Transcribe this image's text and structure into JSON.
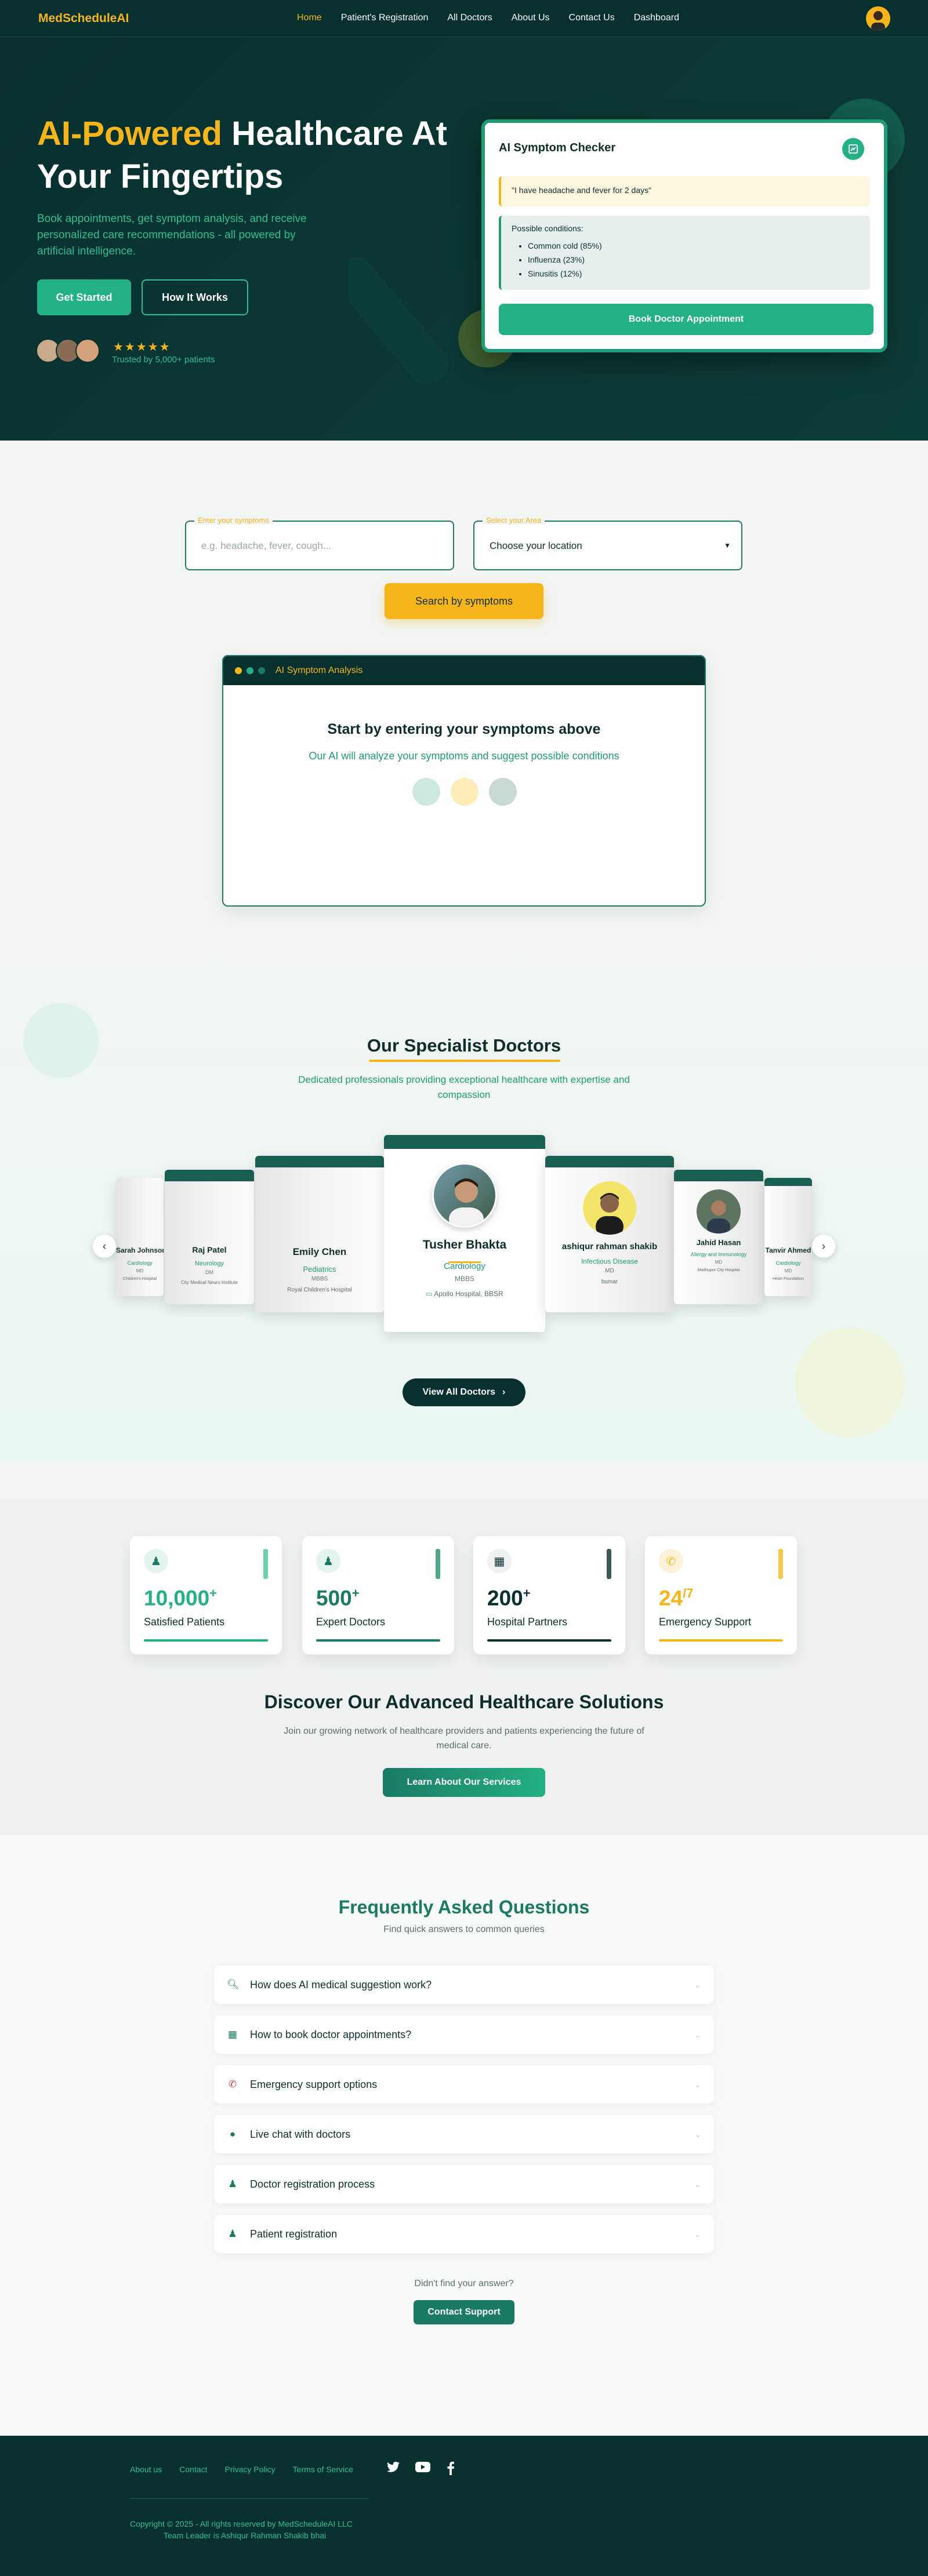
{
  "nav": {
    "logo": "MedScheduleAI",
    "links": [
      "Home",
      "Patient's Registration",
      "All Doctors",
      "About Us",
      "Contact Us",
      "Dashboard"
    ],
    "active": "Home"
  },
  "hero": {
    "title_highlight": "AI-Powered",
    "title_rest": " Healthcare At Your Fingertips",
    "subtitle": "Book appointments, get symptom analysis, and receive personalized care recommendations - all powered by artificial intelligence.",
    "get_started": "Get Started",
    "how_it_works": "How It Works",
    "stars": "★★★★★",
    "trusted": "Trusted by 5,000+ patients",
    "rating": 5
  },
  "checker": {
    "title": "AI Symptom Checker",
    "quote": "\"I have headache and fever for 2 days\"",
    "conditions_label": "Possible conditions:",
    "conditions": [
      "Common cold (85%)",
      "Influenza (23%)",
      "Sinusitis (12%)"
    ],
    "book_button": "Book Doctor Appointment"
  },
  "search": {
    "symptoms_label": "Enter your symptoms",
    "symptoms_placeholder": "e.g. headache, fever, cough...",
    "area_label": "Select your Area",
    "area_value": "Choose your location",
    "button": "Search by symptoms"
  },
  "analysis": {
    "bar_title": "AI Symptom Analysis",
    "heading": "Start by entering your symptoms above",
    "text": "Our AI will analyze your symptoms and suggest possible conditions"
  },
  "doctors": {
    "title": "Our Specialist Doctors",
    "subtitle": "Dedicated professionals providing exceptional healthcare with expertise and compassion",
    "cards": [
      {
        "name": "Sarah Johnson",
        "spec": "Cardiology",
        "deg": "MD",
        "hosp": "Children's Hospital"
      },
      {
        "name": "Raj Patel",
        "spec": "Neurology",
        "deg": "DM",
        "hosp": "City Medical Neuro Institute"
      },
      {
        "name": "Emily Chen",
        "spec": "Pediatrics",
        "deg": "MBBS",
        "hosp": "Royal Children's Hospital"
      },
      {
        "name": "Tusher Bhakta",
        "spec": "Cardiology",
        "deg": "MBBS",
        "hosp": "Apollo Hospital, BBSR"
      },
      {
        "name": "ashiqur rahman shakib",
        "spec": "Infectious Disease",
        "deg": "MD",
        "hosp": "bumar"
      },
      {
        "name": "Jahid Hasan",
        "spec": "Allergy and Immunology",
        "deg": "MD",
        "hosp": "Madhupur City Hospital"
      },
      {
        "name": "Tanvir Ahmed",
        "spec": "Cardiology",
        "deg": "MD",
        "hosp": "Heart Foundation"
      }
    ],
    "view_all": "View All Doctors"
  },
  "stats": [
    {
      "num": "10,000",
      "suffix": "+",
      "label": "Satisfied Patients",
      "color": "#23b084"
    },
    {
      "num": "500",
      "suffix": "+",
      "label": "Expert Doctors",
      "color": "#1a7a63"
    },
    {
      "num": "200",
      "suffix": "+",
      "label": "Hospital Partners",
      "color": "#07302e"
    },
    {
      "num": "24",
      "suffix": "/7",
      "label": "Emergency Support",
      "color": "#f6b51a"
    }
  ],
  "discover": {
    "title": "Discover Our Advanced Healthcare Solutions",
    "text": "Join our growing network of healthcare providers and patients experiencing the future of medical care.",
    "button": "Learn About Our Services"
  },
  "faq": {
    "title": "Frequently Asked Questions",
    "subtitle": "Find quick answers to common queries",
    "items": [
      {
        "q": "How does AI medical suggestion work?",
        "icon": "search-icon"
      },
      {
        "q": "How to book doctor appointments?",
        "icon": "calendar-icon"
      },
      {
        "q": "Emergency support options",
        "icon": "phone-icon"
      },
      {
        "q": "Live chat with doctors",
        "icon": "chat-icon"
      },
      {
        "q": "Doctor registration process",
        "icon": "doctor-icon"
      },
      {
        "q": "Patient registration",
        "icon": "user-icon"
      }
    ],
    "didnt_find": "Didn't find your answer?",
    "contact": "Contact Support"
  },
  "footer": {
    "links": [
      "About us",
      "Contact",
      "Privacy Policy",
      "Terms of Service"
    ],
    "copyright": "Copyright © 2025 - All rights reserved by MedScheduleAI LLC",
    "team": "Team Leader is Ashiqur Rahman Shakib bhai"
  },
  "colors": {
    "brand": "#07302e",
    "accent": "#f6b51a",
    "green": "#23b084"
  }
}
